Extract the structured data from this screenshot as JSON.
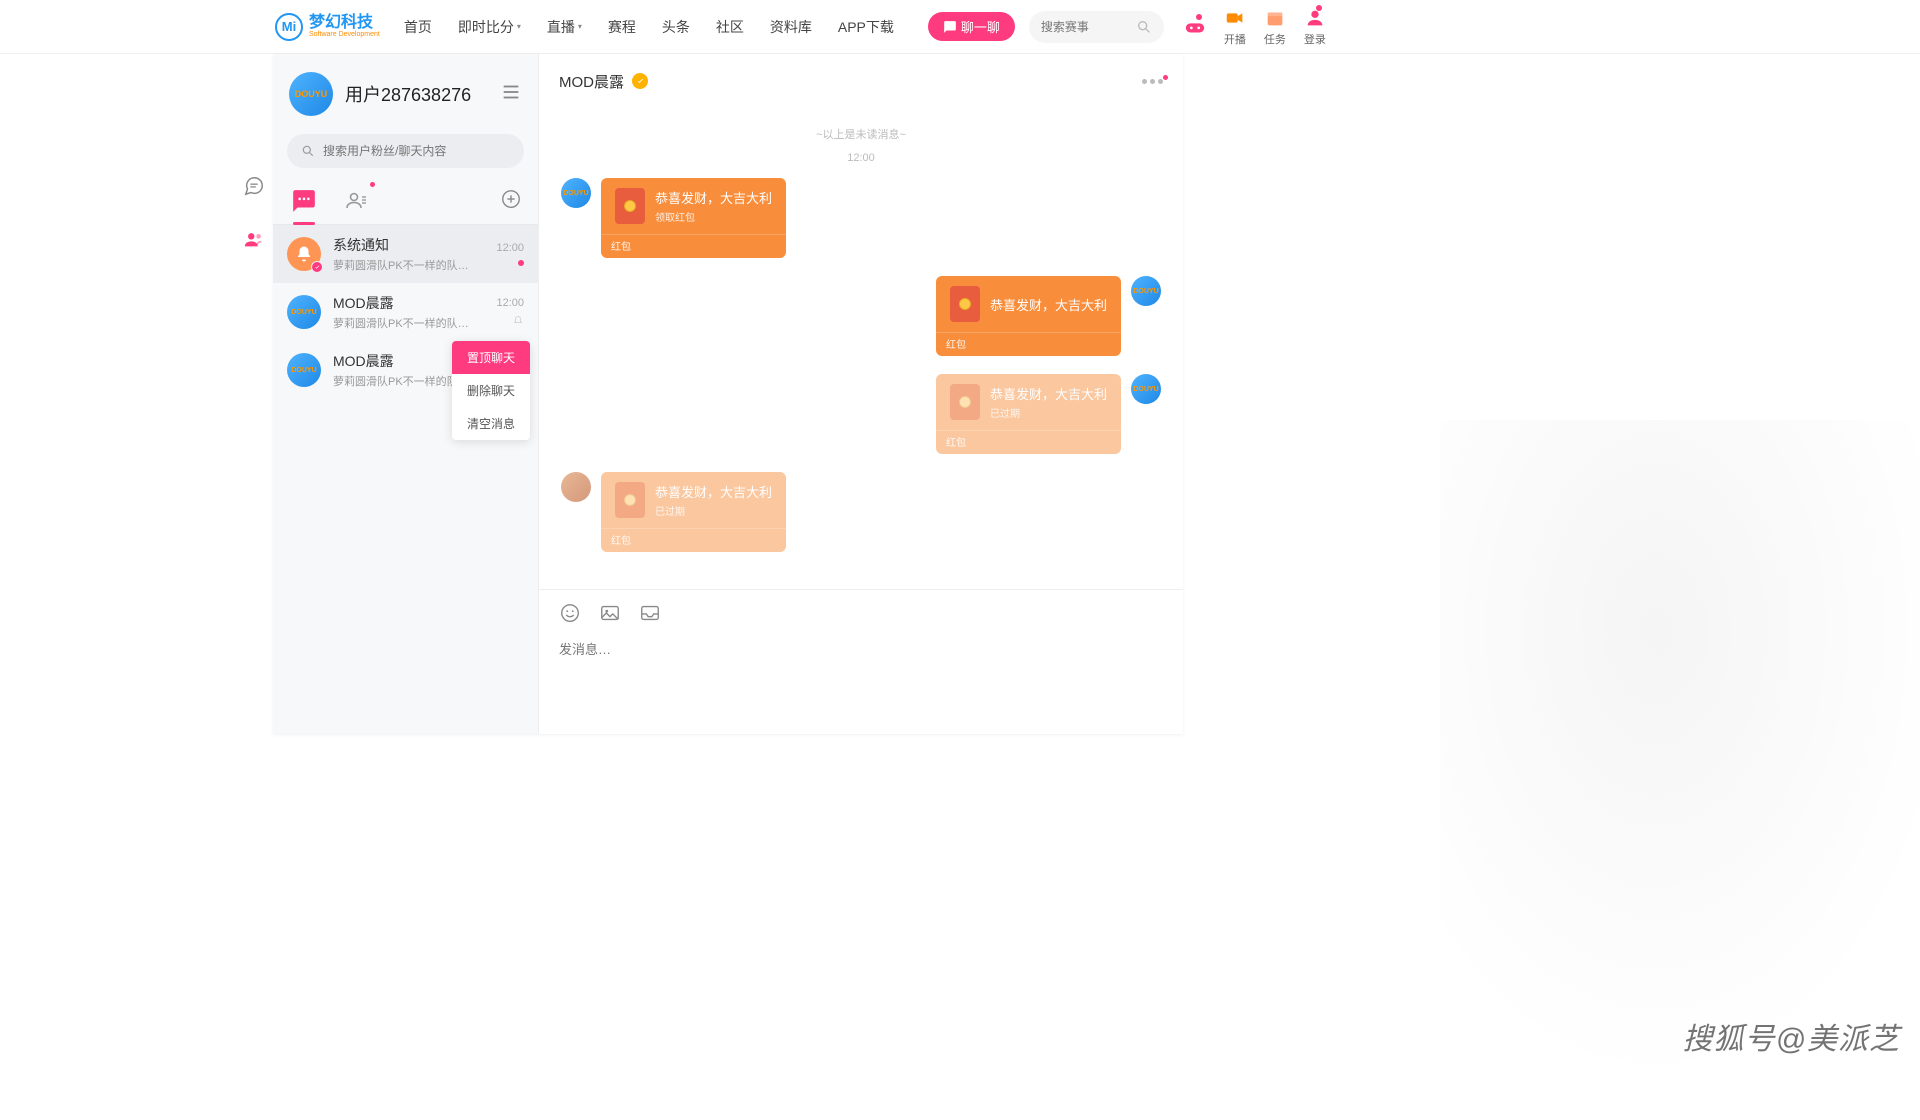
{
  "topnav": {
    "logo_cn": "梦幻科技",
    "logo_en": "Software Development",
    "logo_badge": "Mi",
    "items": [
      "首页",
      "即时比分",
      "直播",
      "赛程",
      "头条",
      "社区",
      "资料库",
      "APP下载"
    ],
    "chat_btn": "聊一聊",
    "search_placeholder": "搜索赛事",
    "right": [
      {
        "label": "开播",
        "color": "#ff8c00"
      },
      {
        "label": "任务",
        "color": "#ff9d6e"
      },
      {
        "label": "登录",
        "color": "#ff3b7f"
      }
    ]
  },
  "sidebar": {
    "user_title": "用户287638276",
    "avatar_text": "DOUYU",
    "search_placeholder": "搜索用户粉丝/聊天内容",
    "conversations": [
      {
        "name": "系统通知",
        "snippet": "萝莉圆滑队PK不一样的队…",
        "time": "12:00",
        "type": "system",
        "selected": true,
        "unread": true
      },
      {
        "name": "MOD晨露",
        "snippet": "萝莉圆滑队PK不一样的队…",
        "time": "12:00",
        "type": "user",
        "muted": true
      },
      {
        "name": "MOD晨露",
        "snippet": "萝莉圆滑队PK不一样的队…",
        "time": "",
        "type": "user",
        "context_menu": true
      }
    ],
    "context_menu": [
      "置顶聊天",
      "删除聊天",
      "清空消息"
    ]
  },
  "chat": {
    "title": "MOD晨露",
    "unread_divider": "~以上是未读消息~",
    "time_divider": "12:00",
    "redpacket": {
      "title": "恭喜发财，大吉大利",
      "sub_open": "领取红包",
      "sub_expired": "已过期",
      "footer": "红包"
    },
    "msg_placeholder": "发消息…"
  },
  "watermark": "搜狐号@美派芝"
}
